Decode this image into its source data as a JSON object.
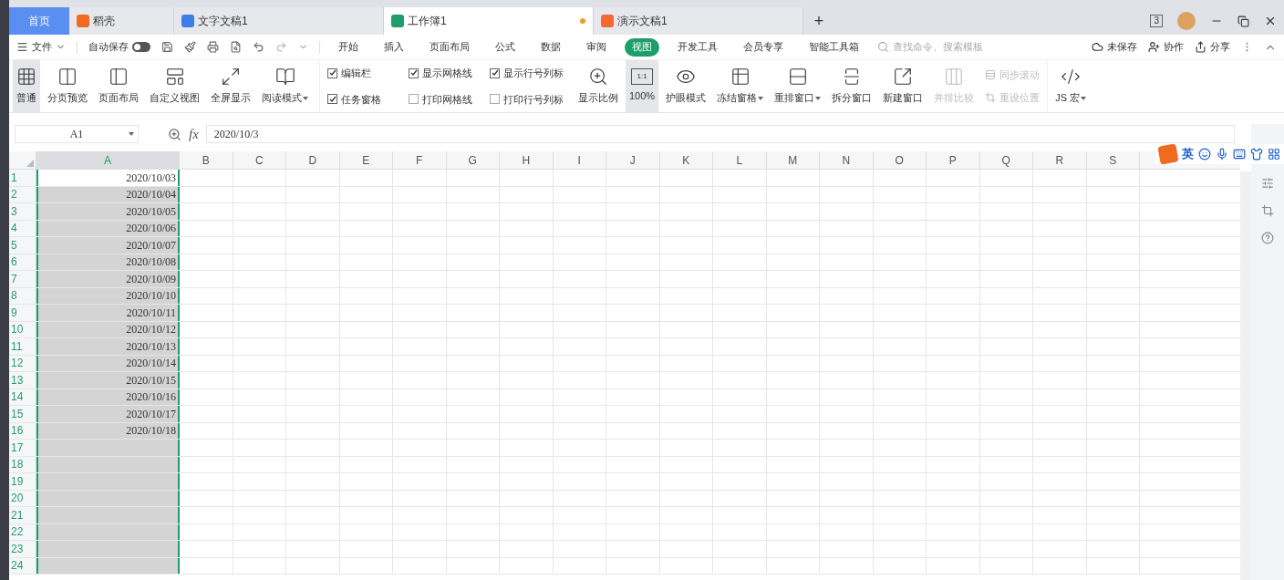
{
  "tabs": [
    {
      "label": "首页",
      "kind": "home",
      "selected": false
    },
    {
      "label": "稻壳",
      "kind": "daoke",
      "selected": false
    },
    {
      "label": "文字文稿1",
      "kind": "writer",
      "selected": false
    },
    {
      "label": "工作簿1",
      "kind": "sheet",
      "selected": true
    },
    {
      "label": "演示文稿1",
      "kind": "slides",
      "selected": false
    }
  ],
  "new_tab": "+",
  "window_badge": "3",
  "menu": {
    "file": "文件",
    "autosave": "自动保存",
    "autosave_on": false,
    "items": [
      {
        "label": "开始",
        "selected": false
      },
      {
        "label": "插入",
        "selected": false
      },
      {
        "label": "页面布局",
        "selected": false
      },
      {
        "label": "公式",
        "selected": false
      },
      {
        "label": "数据",
        "selected": false
      },
      {
        "label": "审阅",
        "selected": false
      },
      {
        "label": "视图",
        "selected": true
      },
      {
        "label": "开发工具",
        "selected": false
      },
      {
        "label": "会员专享",
        "selected": false
      },
      {
        "label": "智能工具箱",
        "selected": false
      }
    ],
    "search_placeholder": "查找命令、搜索模板",
    "actions": [
      {
        "label": "未保存",
        "kind": "cloud"
      },
      {
        "label": "协作",
        "kind": "user"
      },
      {
        "label": "分享",
        "kind": "share"
      }
    ]
  },
  "ribbon": {
    "views": [
      {
        "label": "普通",
        "kind": "grid",
        "selected": true
      },
      {
        "label": "分页预览",
        "kind": "page",
        "selected": false
      },
      {
        "label": "页面布局",
        "kind": "layout",
        "selected": false
      },
      {
        "label": "自定义视图",
        "kind": "custom",
        "selected": false
      },
      {
        "label": "全屏显示",
        "kind": "full",
        "selected": false
      },
      {
        "label": "阅读模式",
        "kind": "read",
        "selected": false
      }
    ],
    "checks": [
      {
        "label": "编辑栏",
        "checked": true
      },
      {
        "label": "任务窗格",
        "checked": true
      },
      {
        "label": "显示网格线",
        "checked": true
      },
      {
        "label": "打印网格线",
        "checked": false
      },
      {
        "label": "显示行号列标",
        "checked": true
      },
      {
        "label": "打印行号列标",
        "checked": false
      }
    ],
    "zoom": [
      {
        "label": "显示比例",
        "kind": "zoom",
        "selected": false
      },
      {
        "label": "100%",
        "kind": "ratio",
        "icon_text": "1:1",
        "selected": true
      },
      {
        "label": "护眼模式",
        "kind": "eye",
        "selected": false
      }
    ],
    "windows": [
      {
        "label": "冻结窗格",
        "kind": "freeze",
        "disabled": false
      },
      {
        "label": "重排窗口",
        "kind": "arrange",
        "disabled": false
      },
      {
        "label": "拆分窗口",
        "kind": "split",
        "disabled": false
      },
      {
        "label": "新建窗口",
        "kind": "new",
        "disabled": false
      },
      {
        "label": "并排比较",
        "kind": "compare",
        "disabled": true
      }
    ],
    "sync": [
      {
        "label": "同步滚动",
        "disabled": true
      },
      {
        "label": "重设位置",
        "disabled": true
      }
    ],
    "macro": "JS 宏"
  },
  "formula_bar": {
    "cell": "A1",
    "fx": "fx",
    "value": "2020/10/3"
  },
  "ime": {
    "label": "英"
  },
  "columns": [
    "A",
    "B",
    "C",
    "D",
    "E",
    "F",
    "G",
    "H",
    "I",
    "J",
    "K",
    "L",
    "M",
    "N",
    "O",
    "P",
    "Q",
    "R",
    "S"
  ],
  "rows": [
    {
      "n": "1",
      "a": "2020/10/03"
    },
    {
      "n": "2",
      "a": "2020/10/04"
    },
    {
      "n": "3",
      "a": "2020/10/05"
    },
    {
      "n": "4",
      "a": "2020/10/06"
    },
    {
      "n": "5",
      "a": "2020/10/07"
    },
    {
      "n": "6",
      "a": "2020/10/08"
    },
    {
      "n": "7",
      "a": "2020/10/09"
    },
    {
      "n": "8",
      "a": "2020/10/10"
    },
    {
      "n": "9",
      "a": "2020/10/11"
    },
    {
      "n": "10",
      "a": "2020/10/12"
    },
    {
      "n": "11",
      "a": "2020/10/13"
    },
    {
      "n": "12",
      "a": "2020/10/14"
    },
    {
      "n": "13",
      "a": "2020/10/15"
    },
    {
      "n": "14",
      "a": "2020/10/16"
    },
    {
      "n": "15",
      "a": "2020/10/17"
    },
    {
      "n": "16",
      "a": "2020/10/18"
    },
    {
      "n": "17"
    },
    {
      "n": "18"
    },
    {
      "n": "19"
    },
    {
      "n": "20"
    },
    {
      "n": "21"
    },
    {
      "n": "22"
    },
    {
      "n": "23"
    },
    {
      "n": "24"
    }
  ]
}
